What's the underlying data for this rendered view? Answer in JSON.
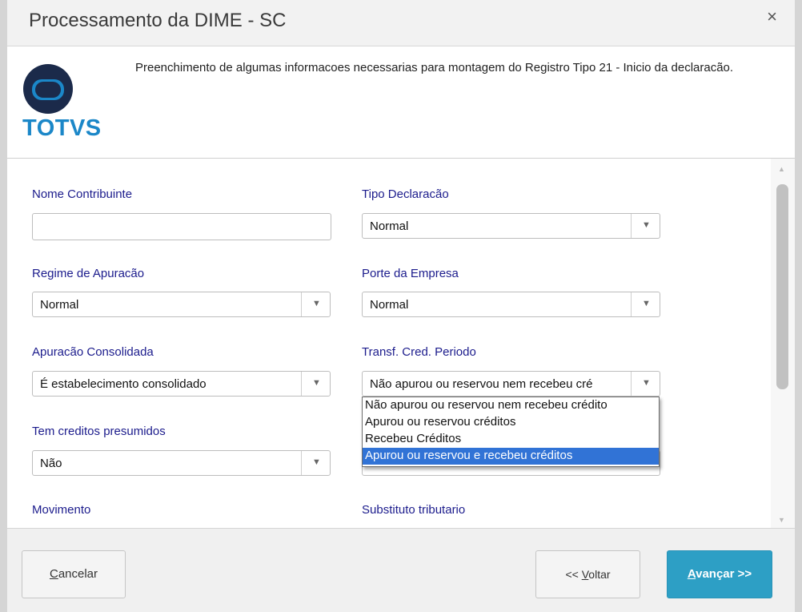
{
  "dialog": {
    "title": "Processamento da DIME - SC",
    "close_label": "×"
  },
  "header": {
    "logo_text": "TOTVS",
    "description": "Preenchimento de algumas informacoes necessarias para montagem do Registro Tipo 21 - Inicio da declaracão."
  },
  "form": {
    "nome_contribuinte": {
      "label": "Nome Contribuinte",
      "value": ""
    },
    "tipo_declaracao": {
      "label": "Tipo Declaracão",
      "value": "Normal"
    },
    "regime_apuracao": {
      "label": "Regime de Apuracão",
      "value": "Normal"
    },
    "porte_empresa": {
      "label": "Porte da Empresa",
      "value": "Normal"
    },
    "apuracao_consolidada": {
      "label": "Apuracão Consolidada",
      "value": "É estabelecimento consolidado"
    },
    "transf_cred_periodo": {
      "label": "Transf. Cred. Periodo",
      "value": "Não apurou ou reservou nem recebeu cré",
      "options": [
        "Não apurou ou reservou nem recebeu crédito",
        "Apurou ou reservou créditos",
        "Recebeu Créditos",
        "Apurou ou reservou e recebeu créditos"
      ],
      "highlighted_option": "Apurou ou reservou e recebeu créditos"
    },
    "creditos_presumidos": {
      "label": "Tem creditos presumidos",
      "value": "Não"
    },
    "movimento": {
      "label": "Movimento"
    },
    "substituto_tributario": {
      "label": "Substituto tributario"
    }
  },
  "footer": {
    "cancel_hotkey": "C",
    "cancel_rest": "ancelar",
    "back_prefix": "<< ",
    "back_hotkey": "V",
    "back_rest": "oltar",
    "next_hotkey": "A",
    "next_rest": "vançar >>"
  },
  "colors": {
    "label": "#1b1b8c",
    "brand": "#1b87c8",
    "primary_button": "#2d9fc5",
    "selection": "#3173d6"
  },
  "icons": {
    "close": "close-icon",
    "dropdown_arrow": "chevron-down-icon",
    "logo": "totvs-logo-icon"
  }
}
